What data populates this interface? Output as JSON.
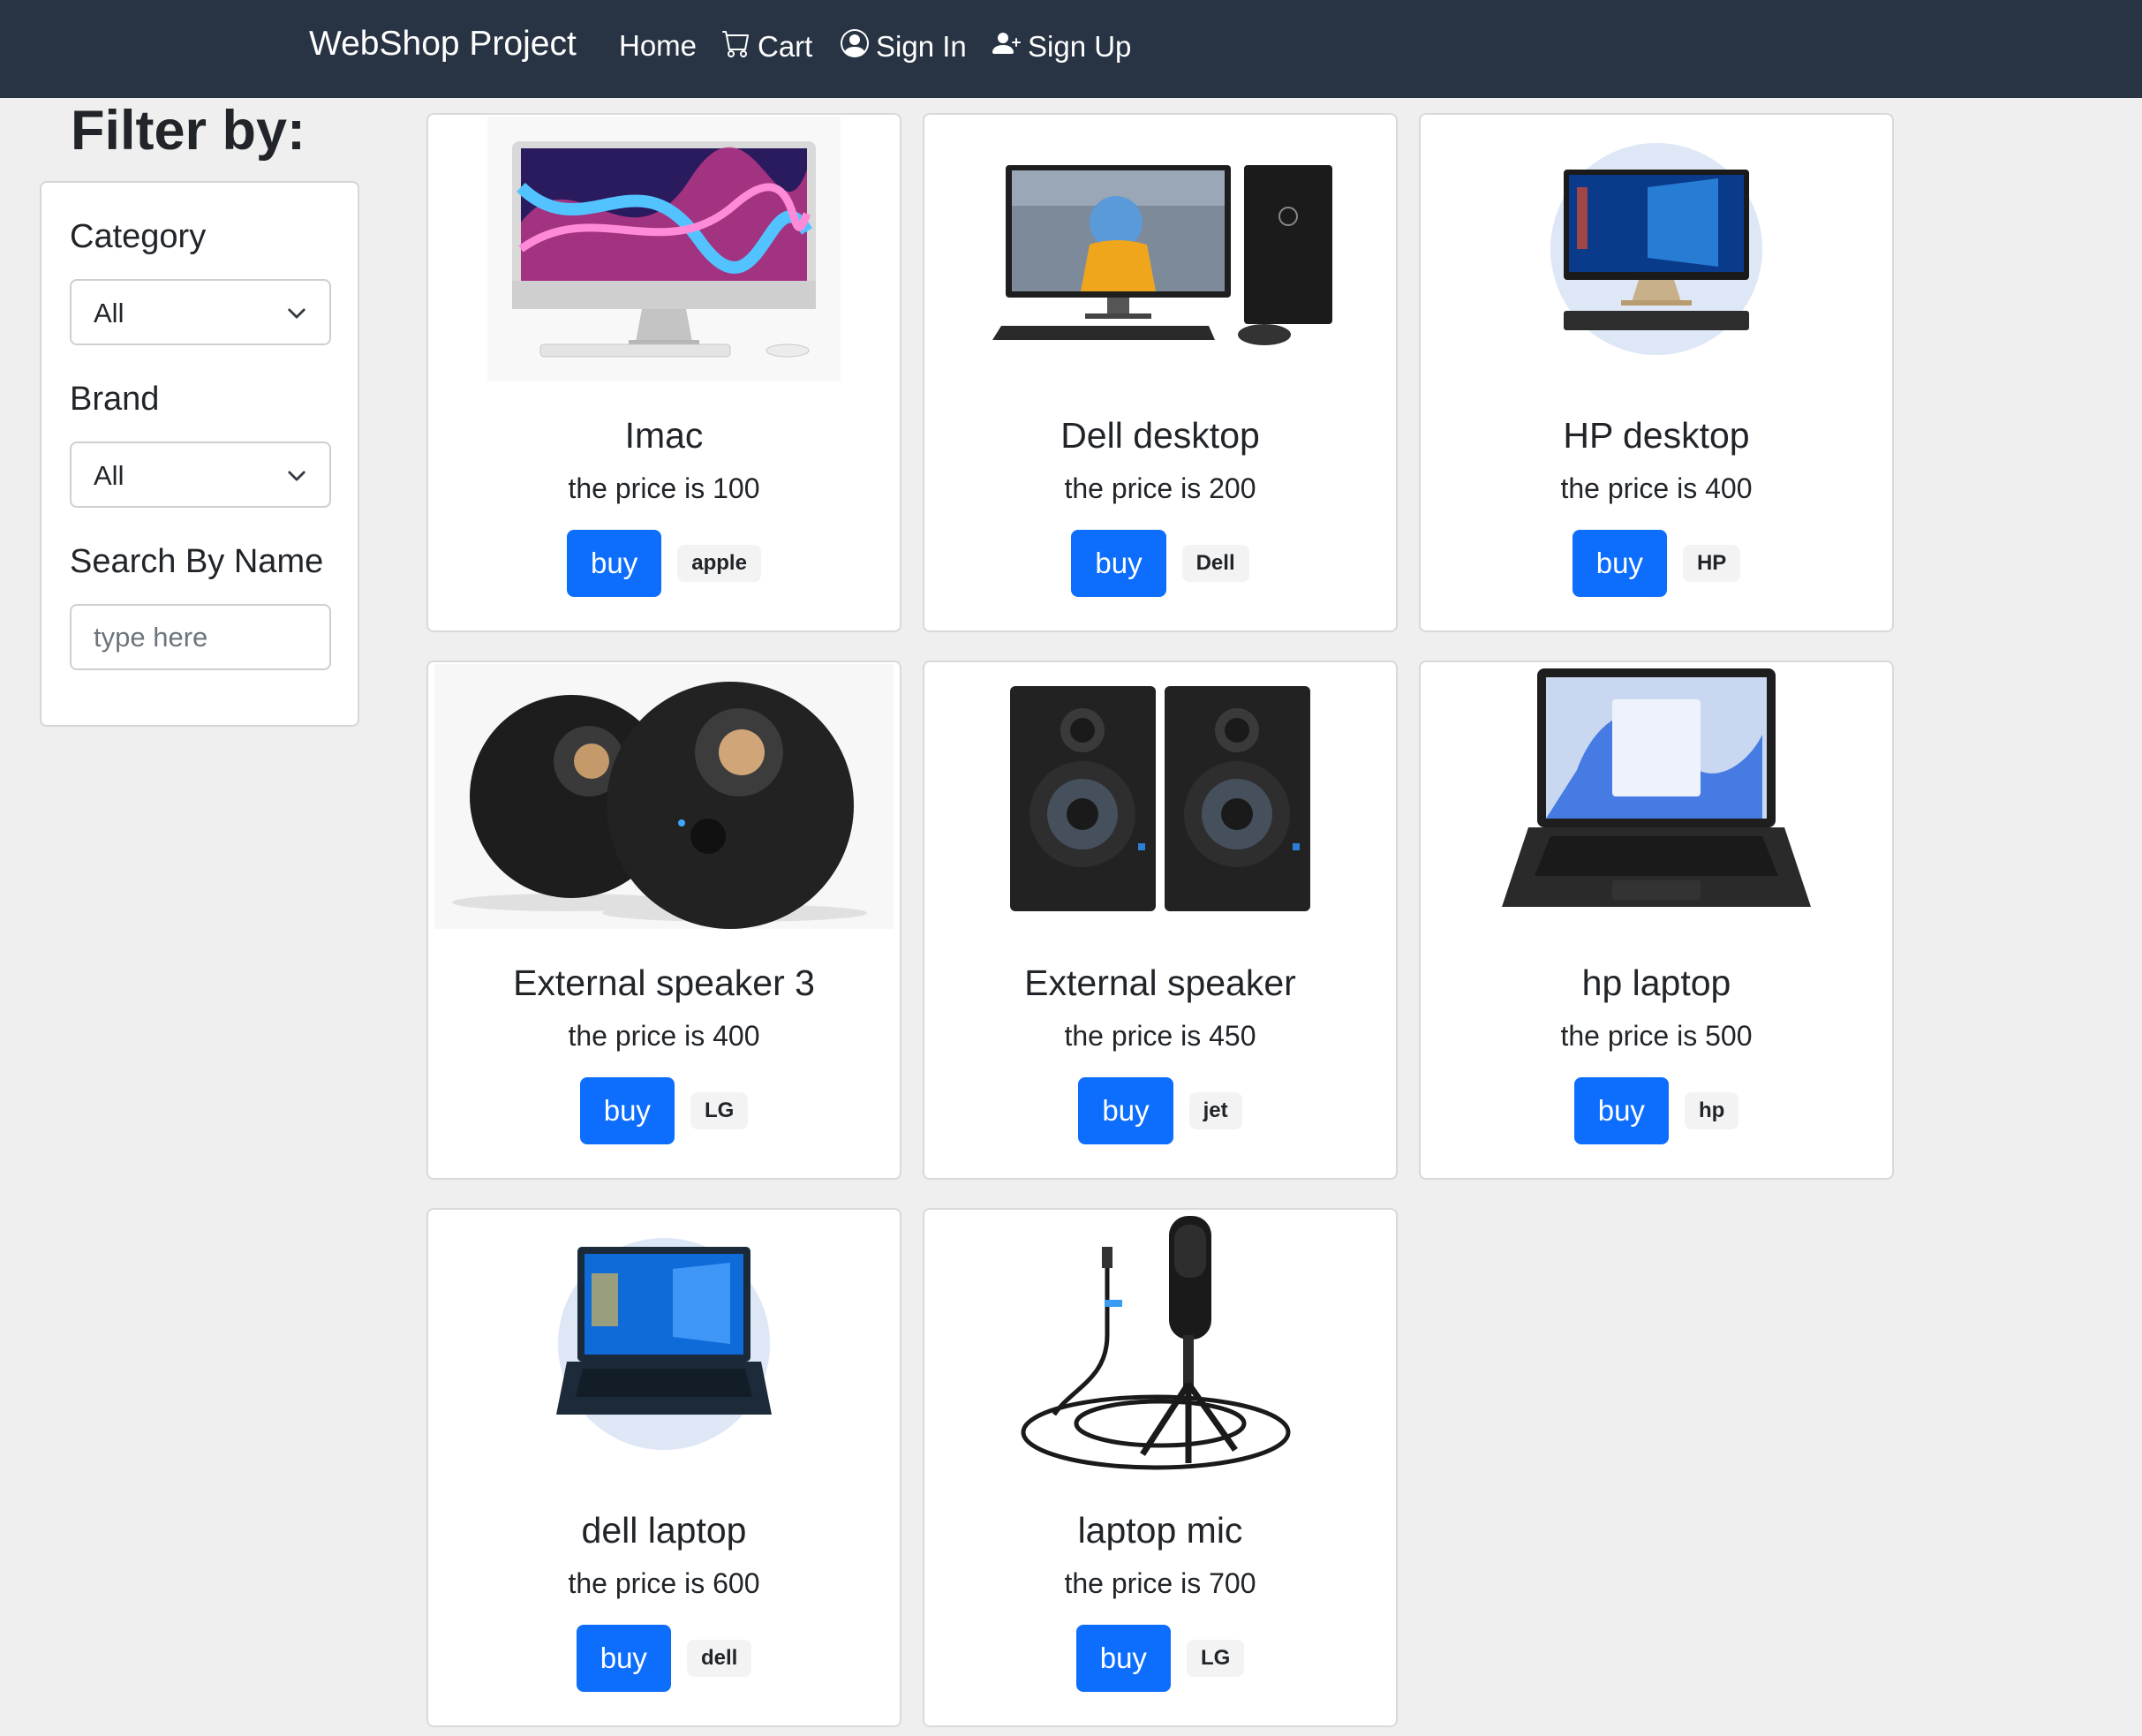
{
  "navbar": {
    "brand": "WebShop Project",
    "links": [
      {
        "label": "Home",
        "icon": ""
      },
      {
        "label": "Cart",
        "icon": "cart-icon"
      },
      {
        "label": "Sign In",
        "icon": "person-circle-icon"
      },
      {
        "label": "Sign Up",
        "icon": "person-plus-icon"
      }
    ]
  },
  "filter": {
    "heading": "Filter by:",
    "category_label": "Category",
    "category_value": "All",
    "brand_label": "Brand",
    "brand_value": "All",
    "search_label": "Search By Name",
    "search_placeholder": "type here",
    "search_value": ""
  },
  "products": [
    {
      "name": "Imac",
      "price_text": "the price is 100",
      "buy_label": "buy",
      "brand": "apple",
      "image": "imac-image"
    },
    {
      "name": "Dell desktop",
      "price_text": "the price is 200",
      "buy_label": "buy",
      "brand": "Dell",
      "image": "dell-desktop-image"
    },
    {
      "name": "HP desktop",
      "price_text": "the price is 400",
      "buy_label": "buy",
      "brand": "HP",
      "image": "hp-desktop-image"
    },
    {
      "name": "External speaker 3",
      "price_text": "the price is 400",
      "buy_label": "buy",
      "brand": "LG",
      "image": "round-speakers-image"
    },
    {
      "name": "External speaker",
      "price_text": "the price is 450",
      "buy_label": "buy",
      "brand": "jet",
      "image": "studio-monitors-image"
    },
    {
      "name": "hp laptop",
      "price_text": "the price is 500",
      "buy_label": "buy",
      "brand": "hp",
      "image": "hp-laptop-image"
    },
    {
      "name": "dell laptop",
      "price_text": "the price is 600",
      "buy_label": "buy",
      "brand": "dell",
      "image": "dell-laptop-image"
    },
    {
      "name": "laptop mic",
      "price_text": "the price is 700",
      "buy_label": "buy",
      "brand": "LG",
      "image": "microphone-image"
    }
  ],
  "colors": {
    "navbar_bg": "#283444",
    "page_bg": "#efefef",
    "primary_button": "#0d6efd",
    "badge_bg": "#f3f3f3"
  }
}
